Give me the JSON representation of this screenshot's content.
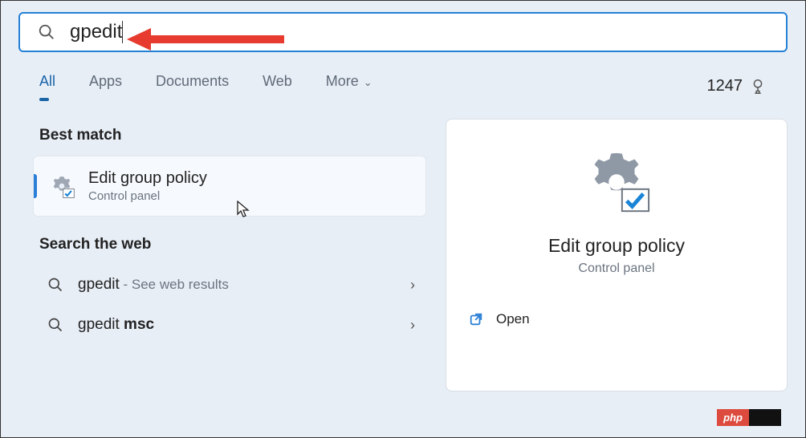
{
  "search": {
    "value": "gpedit"
  },
  "tabs": {
    "items": [
      "All",
      "Apps",
      "Documents",
      "Web",
      "More"
    ],
    "active_index": 0
  },
  "points": "1247",
  "sections": {
    "best_match": "Best match",
    "search_web": "Search the web"
  },
  "best": {
    "title": "Edit group policy",
    "subtitle": "Control panel"
  },
  "web_results": [
    {
      "term": "gpedit",
      "suffix": " - See web results"
    },
    {
      "term": "gpedit ",
      "bold": "msc"
    }
  ],
  "detail": {
    "title": "Edit group policy",
    "subtitle": "Control panel",
    "open": "Open"
  },
  "badge": "php"
}
